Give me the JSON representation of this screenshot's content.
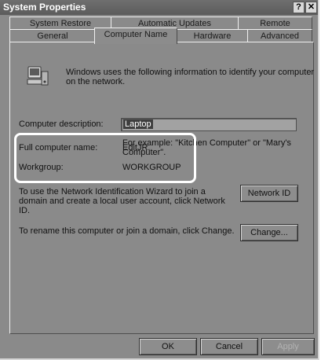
{
  "window": {
    "title": "System Properties",
    "help_label": "?",
    "close_label": "✕"
  },
  "tabs_row1": [
    "System Restore",
    "Automatic Updates",
    "Remote"
  ],
  "tabs_row2": [
    "General",
    "Computer Name",
    "Hardware",
    "Advanced"
  ],
  "active_tab": "Computer Name",
  "intro_text_line1": "Windows uses the following information to identify your computer",
  "intro_text_line2": "on the network.",
  "description": {
    "label": "Computer description:",
    "value": "Laptop",
    "example_line1": "For example: \"Kitchen Computer\" or \"Mary's",
    "example_line2": "Computer\"."
  },
  "full_name": {
    "label": "Full computer name:",
    "value": "EditJR."
  },
  "workgroup": {
    "label": "Workgroup:",
    "value": "WORKGROUP"
  },
  "network_id": {
    "text_line1": "To use the Network Identification Wizard to join a",
    "text_line2": "domain and create a local user account, click Network",
    "text_line3": "ID.",
    "button_label": "Network ID"
  },
  "change": {
    "text": "To rename this computer or join a domain, click Change.",
    "button_label": "Change..."
  },
  "footer": {
    "ok_label": "OK",
    "cancel_label": "Cancel",
    "apply_label": "Apply"
  }
}
